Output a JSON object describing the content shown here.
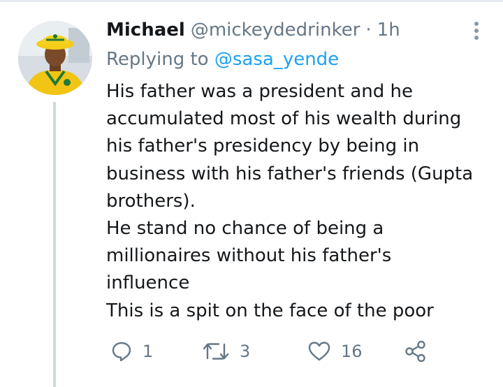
{
  "tweet": {
    "author_name": "Michael",
    "author_handle": "@mickeydedrinker",
    "separator": "·",
    "time": "1h",
    "replying_prefix": "Replying to",
    "replying_to": "@sasa_yende",
    "lines": [
      "His father was a president and he",
      "accumulated most of his wealth during",
      "his father's presidency by being in",
      "business with his father's friends (Gupta",
      "brothers).",
      "He stand no chance of being a",
      "millionaires without his father's",
      "influence",
      "This is a spit on the face of the poor"
    ],
    "actions": {
      "reply_count": "1",
      "retweet_count": "3",
      "like_count": "16"
    }
  },
  "icons": {
    "reply": "reply-icon",
    "retweet": "retweet-icon",
    "like": "heart-icon",
    "share": "share-icon",
    "more": "more-vertical-icon"
  },
  "colors": {
    "text_primary": "#14171a",
    "text_secondary": "#657786",
    "link": "#1da1f2",
    "thread_line": "#cfd9de"
  }
}
